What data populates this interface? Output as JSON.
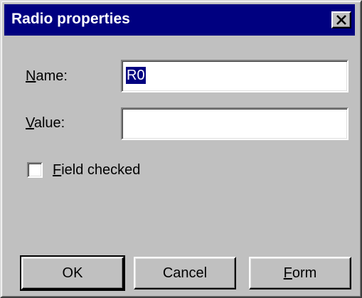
{
  "window": {
    "title": "Radio properties",
    "close_glyph": "✕"
  },
  "form": {
    "name_label_hotkey": "N",
    "name_label_rest": "ame:",
    "name_value": "R0",
    "value_label_hotkey": "V",
    "value_label_rest": "alue:",
    "value_value": "",
    "checkbox_hotkey": "F",
    "checkbox_rest": "ield checked",
    "checkbox_checked": false
  },
  "buttons": {
    "ok": "OK",
    "cancel": "Cancel",
    "form_hotkey": "F",
    "form_rest": "orm"
  },
  "icons": {
    "close": "close-icon"
  }
}
